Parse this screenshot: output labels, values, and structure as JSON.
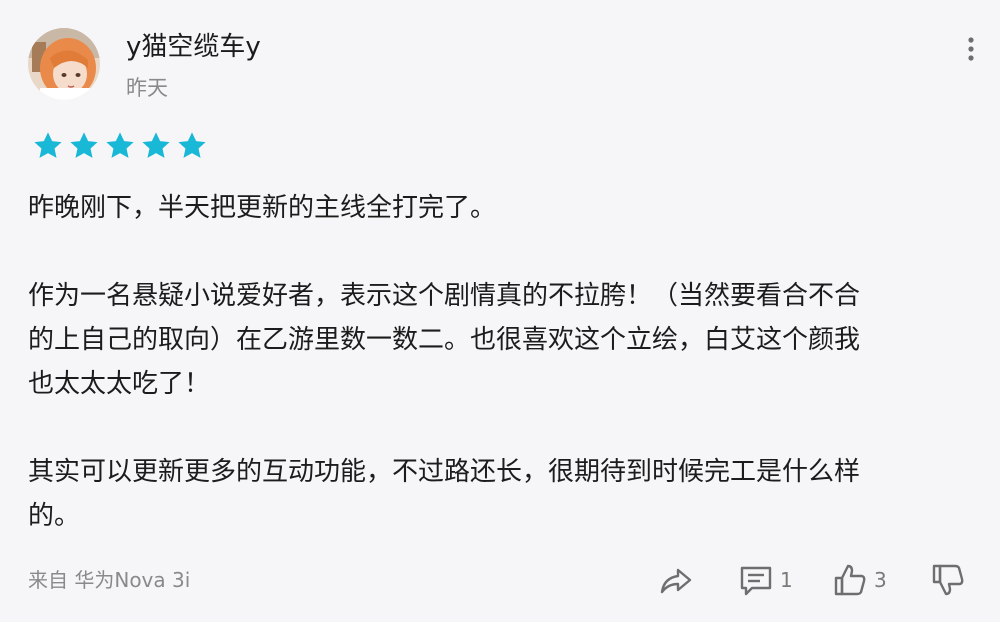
{
  "user": {
    "name": "y猫空缆车y",
    "time": "昨天",
    "avatar_icon": "avatar-girl-orange-hair"
  },
  "rating": {
    "stars": 5,
    "max": 5,
    "color": "#19b8d6"
  },
  "review": {
    "p1": "昨晚刚下，半天把更新的主线全打完了。",
    "p2_line1": "作为一名悬疑小说爱好者，表示这个剧情真的不拉胯！（当然要看合不合",
    "p2_line2": "的上自己的取向）在乙游里数一数二。也很喜欢这个立绘，白艾这个颜我",
    "p2_line3": "也太太太吃了！",
    "p3_line1": "其实可以更新更多的互动功能，不过路还长，很期待到时候完工是什么样",
    "p3_line2": "的。"
  },
  "footer": {
    "device": "来自 华为Nova 3i",
    "reply_count": "1",
    "like_count": "3"
  },
  "icons": {
    "more": "more-vertical-icon",
    "share": "share-icon",
    "comment": "comment-icon",
    "like": "thumbs-up-icon",
    "dislike": "thumbs-down-icon"
  }
}
